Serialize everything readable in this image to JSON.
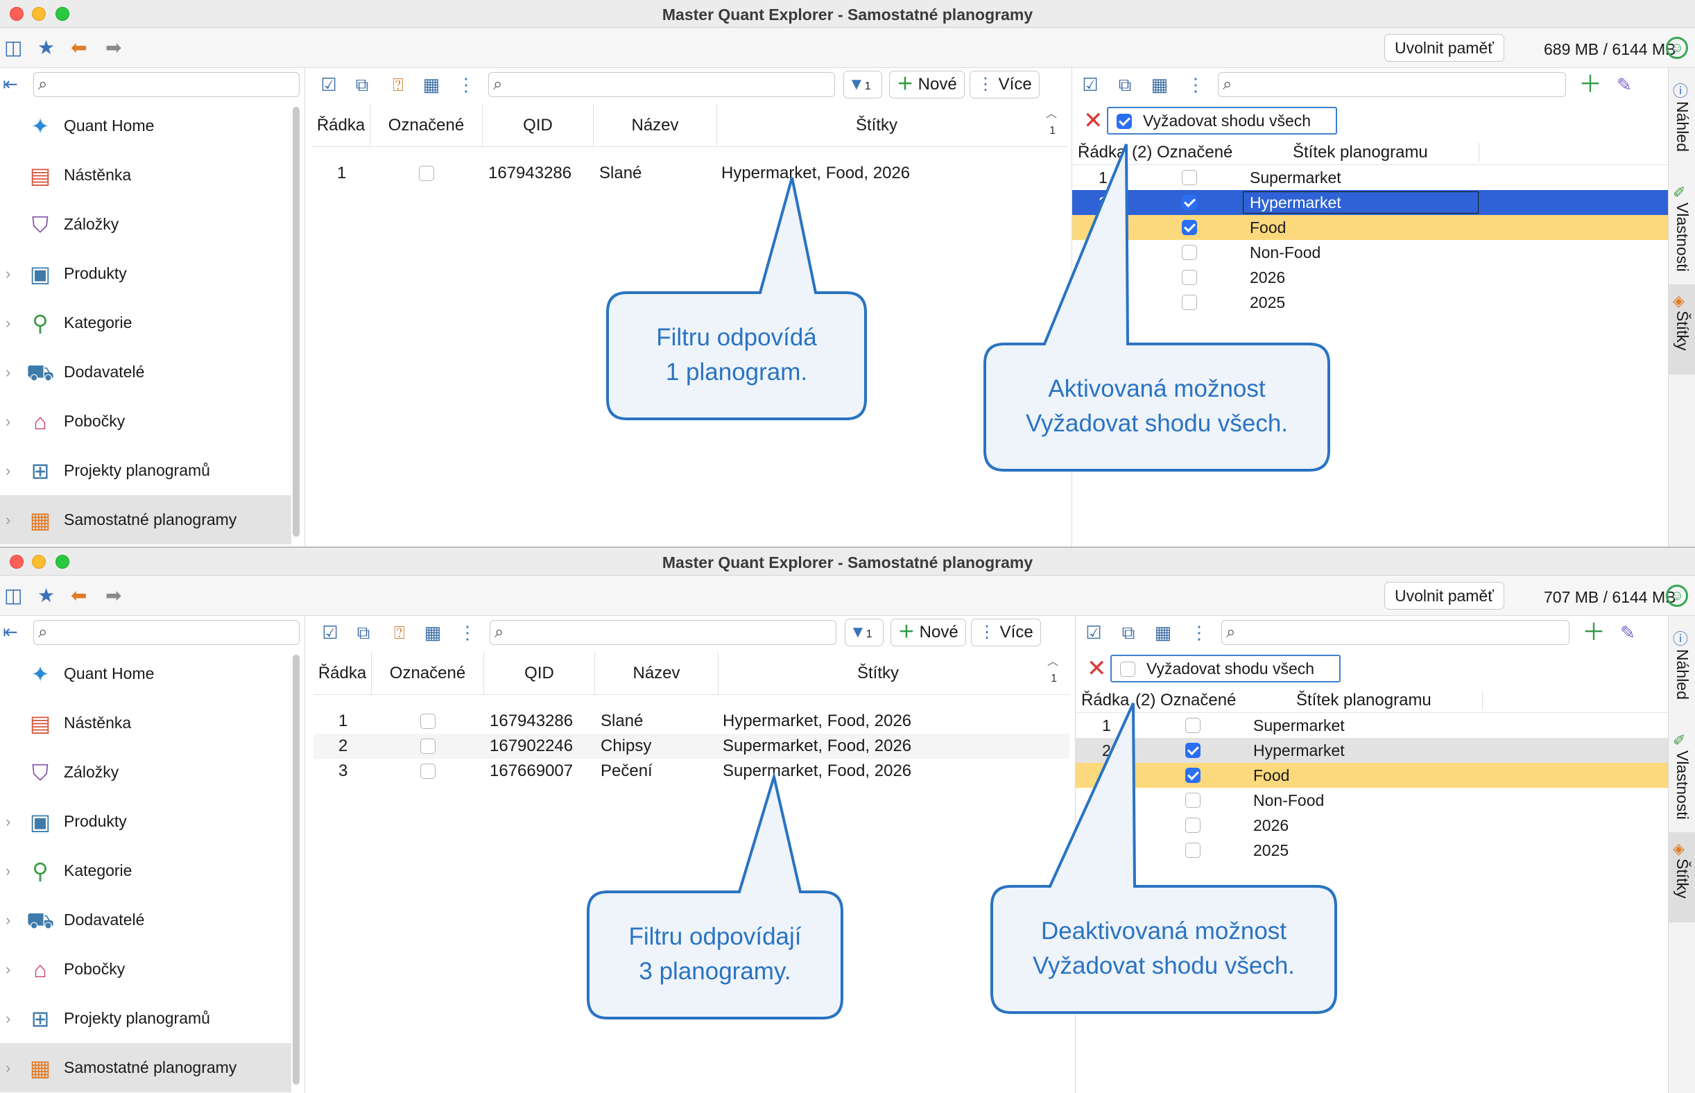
{
  "windows": [
    {
      "title": "Master Quant Explorer - Samostatné planogramy",
      "memory_button": "Uvolnit paměť",
      "memory_usage": "689 MB / 6144 MB",
      "sidebar": [
        {
          "label": "Quant Home",
          "icon": "quant-home-icon"
        },
        {
          "label": "Nástěnka",
          "icon": "dashboard-icon"
        },
        {
          "label": "Záložky",
          "icon": "bookmark-icon"
        },
        {
          "label": "Produkty",
          "icon": "products-icon"
        },
        {
          "label": "Kategorie",
          "icon": "categories-icon"
        },
        {
          "label": "Dodavatelé",
          "icon": "suppliers-icon"
        },
        {
          "label": "Pobočky",
          "icon": "stores-icon"
        },
        {
          "label": "Projekty planogramů",
          "icon": "planogram-projects-icon"
        },
        {
          "label": "Samostatné planogramy",
          "icon": "standalone-planograms-icon"
        }
      ],
      "center": {
        "filter_count": "1",
        "new_label": "Nové",
        "more_label": "Více",
        "columns": [
          "Řádka",
          "Označené",
          "QID",
          "Název",
          "Štítky"
        ],
        "row_count_badge": "1",
        "rows": [
          {
            "n": "1",
            "qid": "167943286",
            "name": "Slané",
            "tags": "Hypermarket, Food, 2026"
          }
        ]
      },
      "right": {
        "require_all_label": "Vyžadovat shodu všech",
        "require_all_checked": true,
        "columns": [
          "Řádka",
          "(2) Označené",
          "Štítek planogramu"
        ],
        "tags": [
          {
            "n": "1",
            "label": "Supermarket",
            "checked": false
          },
          {
            "n": "2",
            "label": "Hypermarket",
            "checked": true
          },
          {
            "n": "3",
            "label": "Food",
            "checked": true
          },
          {
            "n": "4",
            "label": "Non-Food",
            "checked": false
          },
          {
            "n": "5",
            "label": "2026",
            "checked": false
          },
          {
            "n": "6",
            "label": "2025",
            "checked": false
          }
        ]
      },
      "tabs": [
        "Náhled",
        "Vlastnosti",
        "Štítky"
      ],
      "callouts": {
        "center": [
          "Filtru odpovídá",
          "1 planogram."
        ],
        "right": [
          "Aktivovaná možnost",
          "Vyžadovat shodu všech."
        ]
      }
    },
    {
      "title": "Master Quant Explorer - Samostatné planogramy",
      "memory_button": "Uvolnit paměť",
      "memory_usage": "707 MB / 6144 MB",
      "sidebar": [
        {
          "label": "Quant Home",
          "icon": "quant-home-icon"
        },
        {
          "label": "Nástěnka",
          "icon": "dashboard-icon"
        },
        {
          "label": "Záložky",
          "icon": "bookmark-icon"
        },
        {
          "label": "Produkty",
          "icon": "products-icon"
        },
        {
          "label": "Kategorie",
          "icon": "categories-icon"
        },
        {
          "label": "Dodavatelé",
          "icon": "suppliers-icon"
        },
        {
          "label": "Pobočky",
          "icon": "stores-icon"
        },
        {
          "label": "Projekty planogramů",
          "icon": "planogram-projects-icon"
        },
        {
          "label": "Samostatné planogramy",
          "icon": "standalone-planograms-icon"
        }
      ],
      "center": {
        "filter_count": "1",
        "new_label": "Nové",
        "more_label": "Více",
        "columns": [
          "Řádka",
          "Označené",
          "QID",
          "Název",
          "Štítky"
        ],
        "row_count_badge": "1",
        "rows": [
          {
            "n": "1",
            "qid": "167943286",
            "name": "Slané",
            "tags": "Hypermarket, Food, 2026"
          },
          {
            "n": "2",
            "qid": "167902246",
            "name": "Chipsy",
            "tags": "Supermarket, Food, 2026"
          },
          {
            "n": "3",
            "qid": "167669007",
            "name": "Pečení",
            "tags": "Supermarket, Food, 2026"
          }
        ]
      },
      "right": {
        "require_all_label": "Vyžadovat shodu všech",
        "require_all_checked": false,
        "columns": [
          "Řádka",
          "(2) Označené",
          "Štítek planogramu"
        ],
        "tags": [
          {
            "n": "1",
            "label": "Supermarket",
            "checked": false
          },
          {
            "n": "2",
            "label": "Hypermarket",
            "checked": true
          },
          {
            "n": "3",
            "label": "Food",
            "checked": true
          },
          {
            "n": "4",
            "label": "Non-Food",
            "checked": false
          },
          {
            "n": "5",
            "label": "2026",
            "checked": false
          },
          {
            "n": "6",
            "label": "2025",
            "checked": false
          }
        ]
      },
      "tabs": [
        "Náhled",
        "Vlastnosti",
        "Štítky"
      ],
      "callouts": {
        "center": [
          "Filtru odpovídají",
          "3 planogramy."
        ],
        "right": [
          "Deaktivovaná možnost",
          "Vyžadovat shodu všech."
        ]
      }
    }
  ],
  "colors": {
    "accent": "#2a6ef2",
    "selection": "#2e62d6",
    "highlight_row": "#fbd97c",
    "callout_border": "#2a73c2",
    "callout_fill": "#eef4fa",
    "callout_text": "#2a73c2"
  }
}
